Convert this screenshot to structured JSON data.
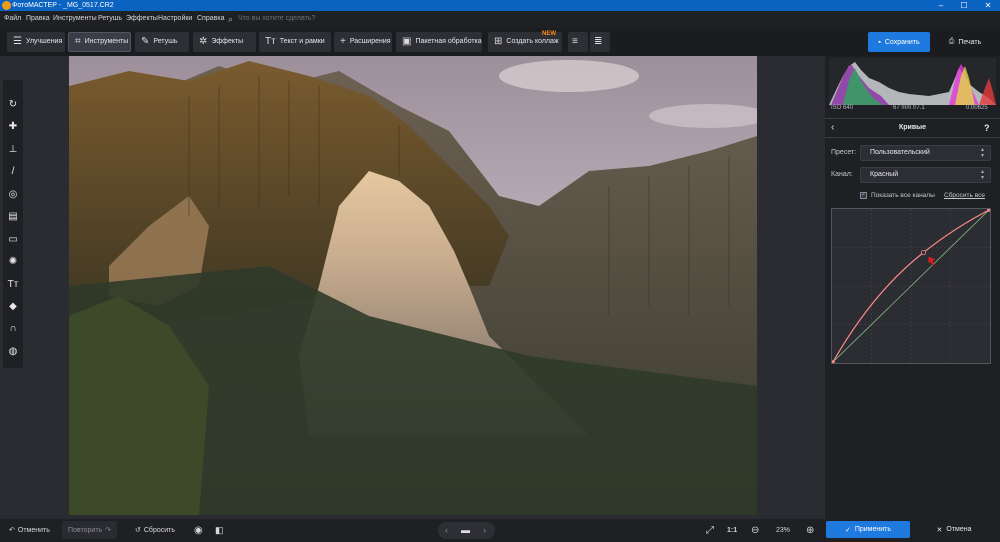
{
  "window": {
    "title": "ФотоМАСТЕР - _MG_0517.CR2",
    "controls": [
      "–",
      "☐",
      "✕"
    ]
  },
  "menu": {
    "items": [
      "Файл",
      "Правка",
      "Инструменты",
      "Ретушь",
      "Эффекты",
      "Настройки",
      "Справка"
    ],
    "search_placeholder": "Что вы хотите сделать?"
  },
  "toolbar": {
    "tabs": [
      {
        "label": "Улучшения",
        "icon": "sliders-icon",
        "glyph": "☰"
      },
      {
        "label": "Инструменты",
        "icon": "crop-icon",
        "glyph": "⌗"
      },
      {
        "label": "Ретушь",
        "icon": "brush-icon",
        "glyph": "✎"
      },
      {
        "label": "Эффекты",
        "icon": "magic-icon",
        "glyph": "✲"
      },
      {
        "label": "Текст и рамки",
        "icon": "text-icon",
        "glyph": "Tт"
      },
      {
        "label": "Расширения",
        "icon": "plus-icon",
        "glyph": "+"
      }
    ],
    "batch_label": "Пакетная обработка",
    "collage_label": "Создать коллаж",
    "new_badge": "NEW",
    "save_label": "Сохранить",
    "print_label": "Печать"
  },
  "tools": [
    {
      "name": "stabilize-icon",
      "glyph": "↻"
    },
    {
      "name": "healing-brush-icon",
      "glyph": "✚"
    },
    {
      "name": "stamp-icon",
      "glyph": "⊥"
    },
    {
      "name": "brush-icon",
      "glyph": "/"
    },
    {
      "name": "radial-filter-icon",
      "glyph": "◎"
    },
    {
      "name": "gradient-filter-icon",
      "glyph": "▤"
    },
    {
      "name": "vignette-icon",
      "glyph": "▭"
    },
    {
      "name": "light-icon",
      "glyph": "✺"
    },
    {
      "name": "text-icon",
      "glyph": "Tт"
    },
    {
      "name": "fill-icon",
      "glyph": "◆"
    },
    {
      "name": "horseshoe-icon",
      "glyph": "∩"
    },
    {
      "name": "globe-icon",
      "glyph": "◍"
    }
  ],
  "histogram": {
    "iso": "ISO 640",
    "lens": "67 mm f/7.1",
    "shutter": "0.00625"
  },
  "curves_panel": {
    "title": "Кривые",
    "help": "?",
    "preset_label": "Пресет:",
    "preset_value": "Пользовательский",
    "channel_label": "Канал:",
    "channel_value": "Красный",
    "show_all_label": "Показать все каналы",
    "show_all_checked": true,
    "reset_all_label": "Сбросить все",
    "curve_color": "#ff8a8a",
    "curve_points": [
      [
        0,
        0
      ],
      [
        0.58,
        0.72
      ],
      [
        1,
        1
      ]
    ]
  },
  "bottom": {
    "undo_label": "Отменить",
    "redo_label": "Повторить",
    "reset_label": "Сбросить",
    "zoom_fit": "1:1",
    "zoom_value": "23%",
    "apply_label": "Применить",
    "cancel_label": "Отмена"
  },
  "colors": {
    "accent": "#1f7ae0",
    "titlebar": "#0a62c1",
    "new_badge": "#ff8a1c"
  }
}
